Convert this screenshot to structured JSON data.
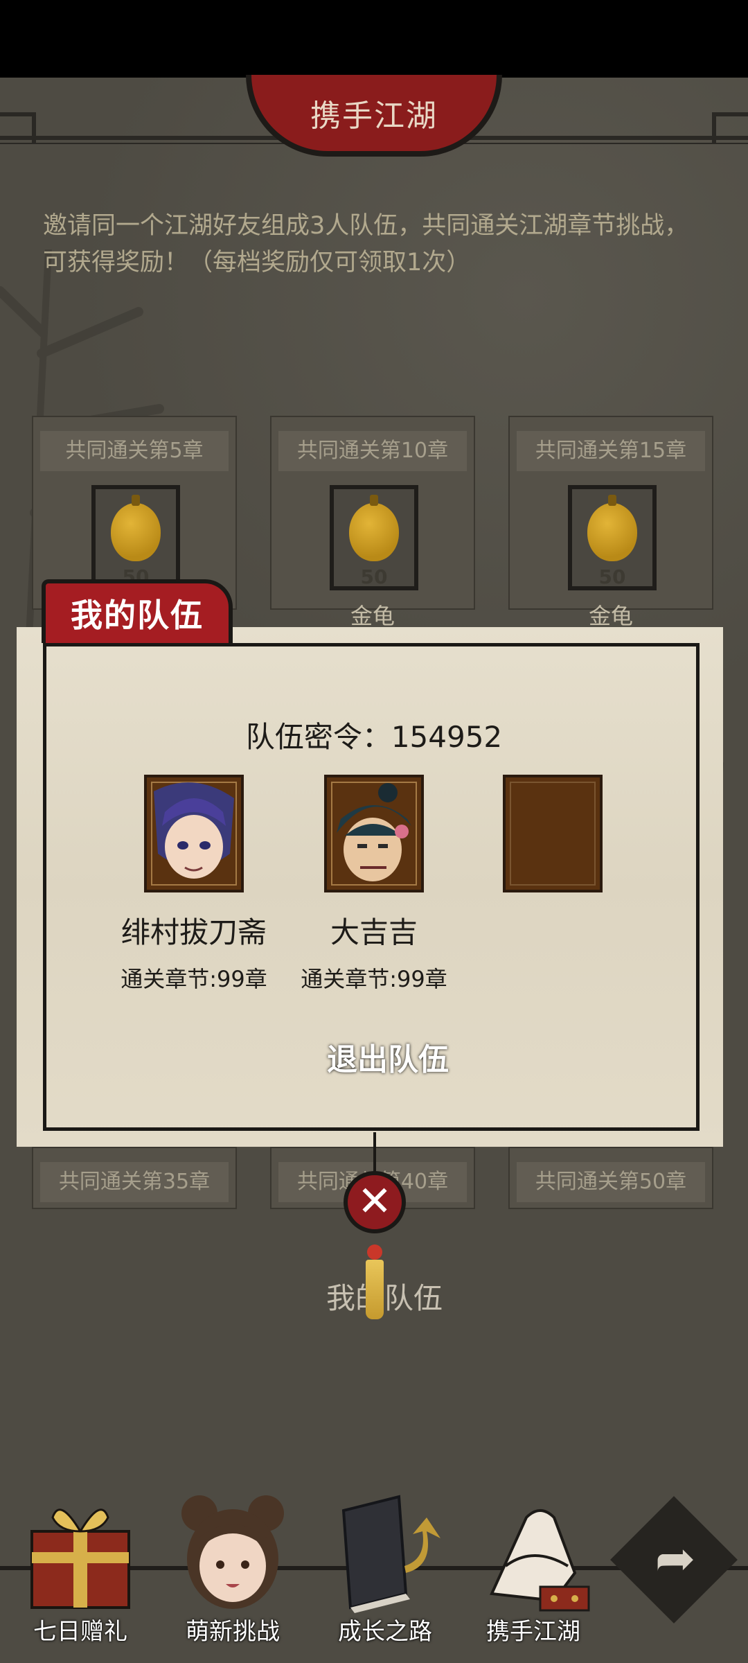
{
  "header": {
    "title": "携手江湖"
  },
  "description": {
    "line1": "邀请同一个江湖好友组成3人队伍，共同通关江湖章节挑战，",
    "line2": "可获得奖励！（每档奖励仅可领取1次）"
  },
  "reward_cards_top": [
    {
      "title": "共同通关第5章",
      "quantity": "50",
      "item_name": ""
    },
    {
      "title": "共同通关第10章",
      "quantity": "50",
      "item_name": "金龟"
    },
    {
      "title": "共同通关第15章",
      "quantity": "50",
      "item_name": "金龟"
    }
  ],
  "reward_cards_bottom": [
    {
      "title": "共同通关第35章"
    },
    {
      "title": "共同通关第40章"
    },
    {
      "title": "共同通关第50章"
    }
  ],
  "team_panel": {
    "tab_title": "我的队伍",
    "code_text": "队伍密令：154952",
    "members": [
      {
        "name": "绯村拔刀斋",
        "chapters": "通关章节:99章"
      },
      {
        "name": "大吉吉",
        "chapters": "通关章节:99章"
      }
    ],
    "leave_button": "退出队伍",
    "close_icon": "close-icon"
  },
  "bottom_button": "我的队伍",
  "nav": [
    {
      "label": "七日赠礼",
      "icon": "gift-box-icon"
    },
    {
      "label": "萌新挑战",
      "icon": "girl-avatar-icon"
    },
    {
      "label": "成长之路",
      "icon": "book-icon"
    },
    {
      "label": "携手江湖",
      "icon": "handshake-icon"
    }
  ],
  "colors": {
    "accent_red": "#a51d22",
    "paper": "#e6dfcd",
    "background": "#4e4b43"
  }
}
